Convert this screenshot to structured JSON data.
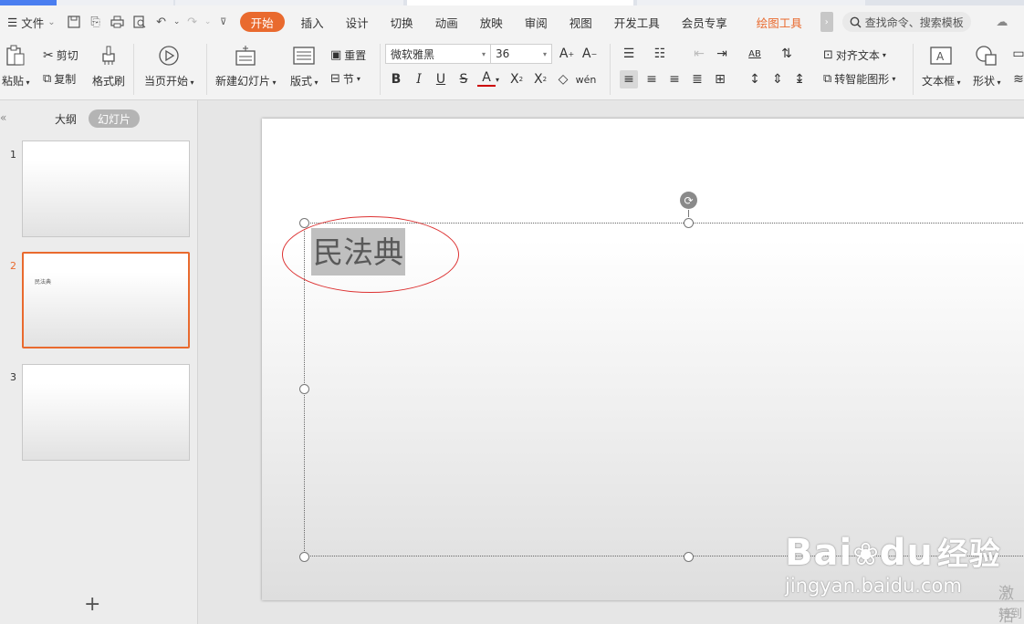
{
  "menubar": {
    "file_label": "文件",
    "tabs": [
      "开始",
      "插入",
      "设计",
      "切换",
      "动画",
      "放映",
      "审阅",
      "视图",
      "开发工具",
      "会员专享"
    ],
    "drawing_tools": "绘图工具",
    "search_placeholder": "查找命令、搜索模板"
  },
  "ribbon": {
    "paste": "粘贴",
    "cut": "剪切",
    "copy": "复制",
    "format_painter": "格式刷",
    "from_current": "当页开始",
    "new_slide": "新建幻灯片",
    "layout": "版式",
    "reset": "重置",
    "section": "节",
    "font_name": "微软雅黑",
    "font_size": "36",
    "align_text": "对齐文本",
    "smart_art": "转智能图形",
    "text_box": "文本框",
    "shape": "形状"
  },
  "left_panel": {
    "tab_outline": "大纲",
    "tab_slides": "幻灯片",
    "slides": [
      {
        "number": "1",
        "text": ""
      },
      {
        "number": "2",
        "text": "民法典"
      },
      {
        "number": "3",
        "text": ""
      }
    ]
  },
  "slide": {
    "title_text": "民法典"
  },
  "watermark": {
    "brand": "Bai",
    "brand2": "du",
    "suffix": "经验",
    "url": "jingyan.baidu.com"
  },
  "activation": {
    "line1": "激活",
    "line2": "转到"
  },
  "colors": {
    "accent": "#e96a2e",
    "annotation": "#dd3333"
  }
}
